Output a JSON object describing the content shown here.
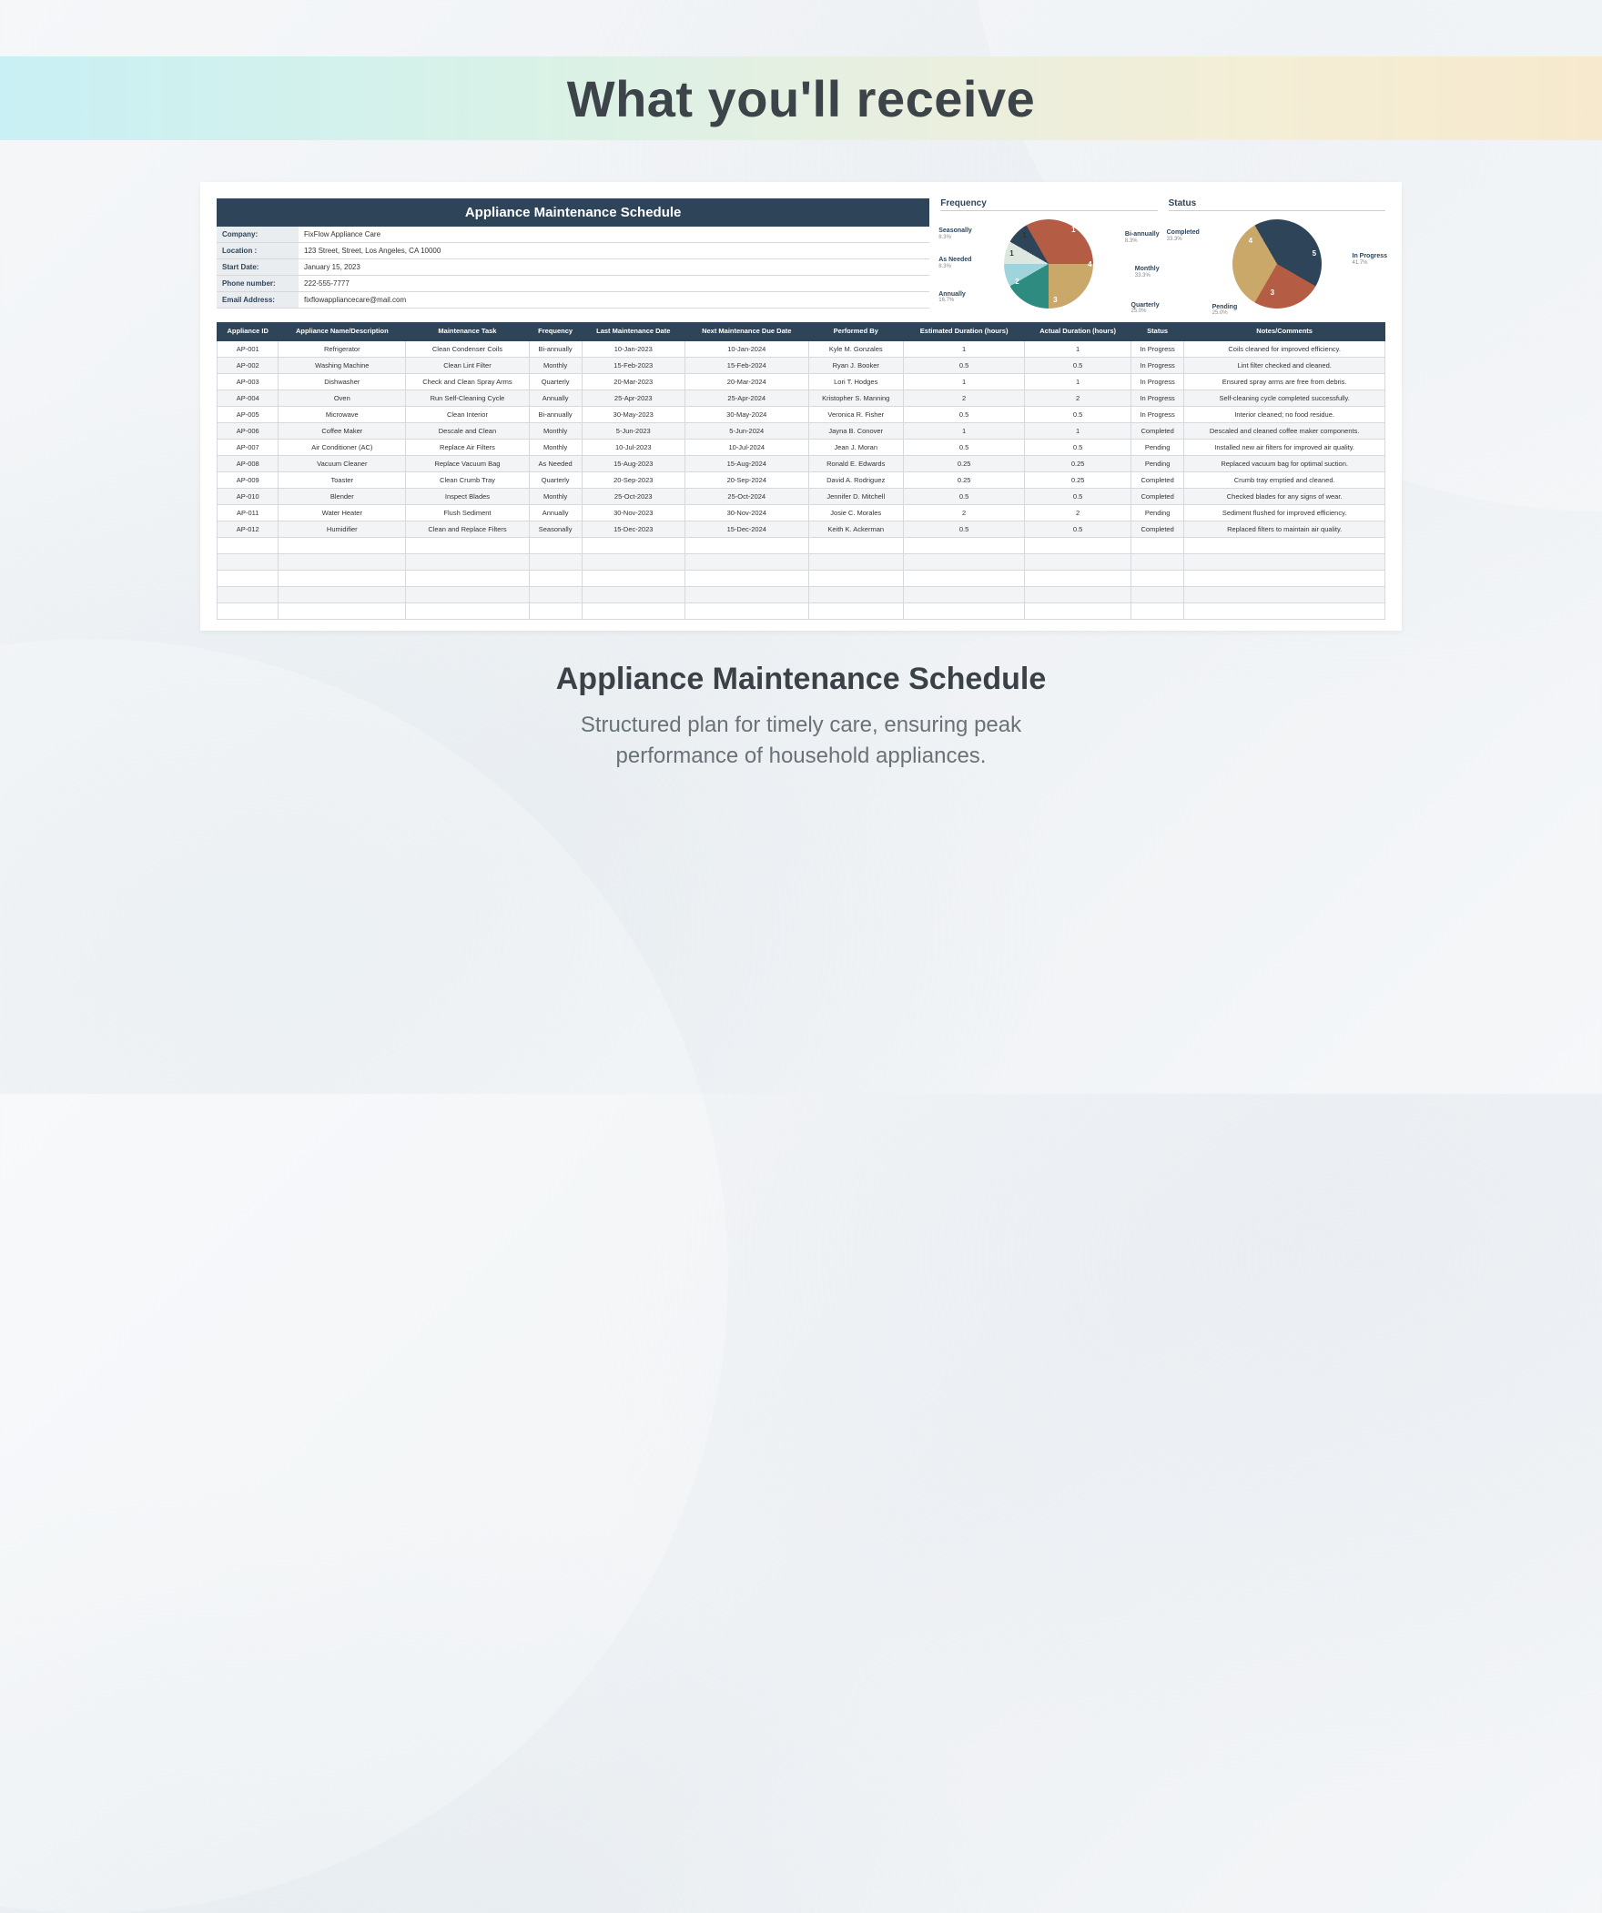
{
  "hero": {
    "title": "What you'll receive"
  },
  "card": {
    "title": "Appliance Maintenance Schedule",
    "meta": [
      {
        "k": "Company:",
        "v": "FixFlow Appliance Care"
      },
      {
        "k": "Location :",
        "v": "123 Street, Street, Los Angeles, CA 10000"
      },
      {
        "k": "Start Date:",
        "v": "January 15, 2023"
      },
      {
        "k": "Phone number:",
        "v": "222-555-7777"
      },
      {
        "k": "Email Address:",
        "v": "fixflowappliancecare@mail.com"
      }
    ]
  },
  "chart_data": [
    {
      "type": "pie",
      "title": "Frequency",
      "series": [
        {
          "name": "Monthly",
          "value": 4,
          "pct": "33.3%",
          "color": "#b55c45"
        },
        {
          "name": "Quarterly",
          "value": 3,
          "pct": "25.0%",
          "color": "#c9a86a"
        },
        {
          "name": "Annually",
          "value": 2,
          "pct": "16.7%",
          "color": "#2e8b7f"
        },
        {
          "name": "As Needed",
          "value": 1,
          "pct": "8.3%",
          "color": "#9fd4dd"
        },
        {
          "name": "Seasonally",
          "value": 1,
          "pct": "8.3%",
          "color": "#dde7e0"
        },
        {
          "name": "Bi-annually",
          "value": 1,
          "pct": "8.3%",
          "color": "#2e4559"
        }
      ]
    },
    {
      "type": "pie",
      "title": "Status",
      "series": [
        {
          "name": "In Progress",
          "value": 5,
          "pct": "41.7%",
          "color": "#2e4559"
        },
        {
          "name": "Pending",
          "value": 3,
          "pct": "25.0%",
          "color": "#b55c45"
        },
        {
          "name": "Completed",
          "value": 4,
          "pct": "33.3%",
          "color": "#c9a86a"
        }
      ]
    }
  ],
  "table": {
    "headers": [
      "Appliance ID",
      "Appliance Name/Description",
      "Maintenance Task",
      "Frequency",
      "Last Maintenance Date",
      "Next Maintenance Due Date",
      "Performed By",
      "Estimated Duration (hours)",
      "Actual Duration (hours)",
      "Status",
      "Notes/Comments"
    ],
    "rows": [
      [
        "AP-001",
        "Refrigerator",
        "Clean Condenser Coils",
        "Bi-annually",
        "10-Jan-2023",
        "10-Jan-2024",
        "Kyle M. Gonzales",
        "1",
        "1",
        "In Progress",
        "Coils cleaned for improved efficiency."
      ],
      [
        "AP-002",
        "Washing Machine",
        "Clean Lint Filter",
        "Monthly",
        "15-Feb-2023",
        "15-Feb-2024",
        "Ryan J. Booker",
        "0.5",
        "0.5",
        "In Progress",
        "Lint filter checked and cleaned."
      ],
      [
        "AP-003",
        "Dishwasher",
        "Check and Clean Spray Arms",
        "Quarterly",
        "20-Mar-2023",
        "20-Mar-2024",
        "Lori T. Hodges",
        "1",
        "1",
        "In Progress",
        "Ensured spray arms are free from debris."
      ],
      [
        "AP-004",
        "Oven",
        "Run Self-Cleaning Cycle",
        "Annually",
        "25-Apr-2023",
        "25-Apr-2024",
        "Kristopher S. Manning",
        "2",
        "2",
        "In Progress",
        "Self-cleaning cycle completed successfully."
      ],
      [
        "AP-005",
        "Microwave",
        "Clean Interior",
        "Bi-annually",
        "30-May-2023",
        "30-May-2024",
        "Veronica R. Fisher",
        "0.5",
        "0.5",
        "In Progress",
        "Interior cleaned; no food residue."
      ],
      [
        "AP-006",
        "Coffee Maker",
        "Descale and Clean",
        "Monthly",
        "5-Jun-2023",
        "5-Jun-2024",
        "Jayna B. Conover",
        "1",
        "1",
        "Completed",
        "Descaled and cleaned coffee maker components."
      ],
      [
        "AP-007",
        "Air Conditioner (AC)",
        "Replace Air Filters",
        "Monthly",
        "10-Jul-2023",
        "10-Jul-2024",
        "Jean J. Moran",
        "0.5",
        "0.5",
        "Pending",
        "Installed new air filters for improved air quality."
      ],
      [
        "AP-008",
        "Vacuum Cleaner",
        "Replace Vacuum Bag",
        "As Needed",
        "15-Aug-2023",
        "15-Aug-2024",
        "Ronald E. Edwards",
        "0.25",
        "0.25",
        "Pending",
        "Replaced vacuum bag for optimal suction."
      ],
      [
        "AP-009",
        "Toaster",
        "Clean Crumb Tray",
        "Quarterly",
        "20-Sep-2023",
        "20-Sep-2024",
        "David A. Rodriguez",
        "0.25",
        "0.25",
        "Completed",
        "Crumb tray emptied and cleaned."
      ],
      [
        "AP-010",
        "Blender",
        "Inspect Blades",
        "Monthly",
        "25-Oct-2023",
        "25-Oct-2024",
        "Jennifer D. Mitchell",
        "0.5",
        "0.5",
        "Completed",
        "Checked blades for any signs of wear."
      ],
      [
        "AP-011",
        "Water Heater",
        "Flush Sediment",
        "Annually",
        "30-Nov-2023",
        "30-Nov-2024",
        "Josie C. Morales",
        "2",
        "2",
        "Pending",
        "Sediment flushed for improved efficiency."
      ],
      [
        "AP-012",
        "Humidifier",
        "Clean and Replace Filters",
        "Seasonally",
        "15-Dec-2023",
        "15-Dec-2024",
        "Keith K. Ackerman",
        "0.5",
        "0.5",
        "Completed",
        "Replaced filters to maintain air quality."
      ]
    ],
    "empty_rows": 5
  },
  "caption": {
    "title": "Appliance Maintenance Schedule",
    "desc1": "Structured plan for timely care, ensuring peak",
    "desc2": "performance of household appliances."
  }
}
